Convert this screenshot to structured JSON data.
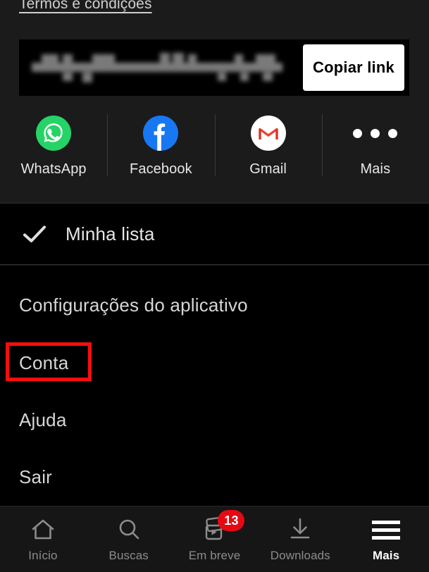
{
  "header": {
    "terms_link": "Termos e condições"
  },
  "share": {
    "link_value": "",
    "link_placeholder": "",
    "link_redacted": true,
    "copy_button_label": "Copiar link",
    "targets": [
      {
        "label": "WhatsApp",
        "icon": "whatsapp-icon",
        "color": "#25D366"
      },
      {
        "label": "Facebook",
        "icon": "facebook-icon",
        "color": "#1877F2"
      },
      {
        "label": "Gmail",
        "icon": "gmail-icon",
        "color": "#FFFFFF"
      },
      {
        "label": "Mais",
        "icon": "more-dots-icon",
        "color": "#FFFFFF"
      }
    ]
  },
  "mylist": {
    "label": "Minha lista",
    "icon": "check-icon",
    "checked": true
  },
  "menu": {
    "items": [
      {
        "label": "Configurações do aplicativo",
        "highlighted": false
      },
      {
        "label": "Conta",
        "highlighted": true
      },
      {
        "label": "Ajuda",
        "highlighted": false
      },
      {
        "label": "Sair",
        "highlighted": false
      }
    ],
    "highlight_color": "#FC0D0D"
  },
  "bottom_nav": {
    "items": [
      {
        "label": "Início",
        "icon": "home-icon",
        "active": false,
        "badge": null
      },
      {
        "label": "Buscas",
        "icon": "search-icon",
        "active": false,
        "badge": null
      },
      {
        "label": "Em breve",
        "icon": "coming-soon-icon",
        "active": false,
        "badge": "13"
      },
      {
        "label": "Downloads",
        "icon": "download-icon",
        "active": false,
        "badge": null
      },
      {
        "label": "Mais",
        "icon": "hamburger-icon",
        "active": true,
        "badge": null
      }
    ],
    "badge_color": "#E50914"
  }
}
